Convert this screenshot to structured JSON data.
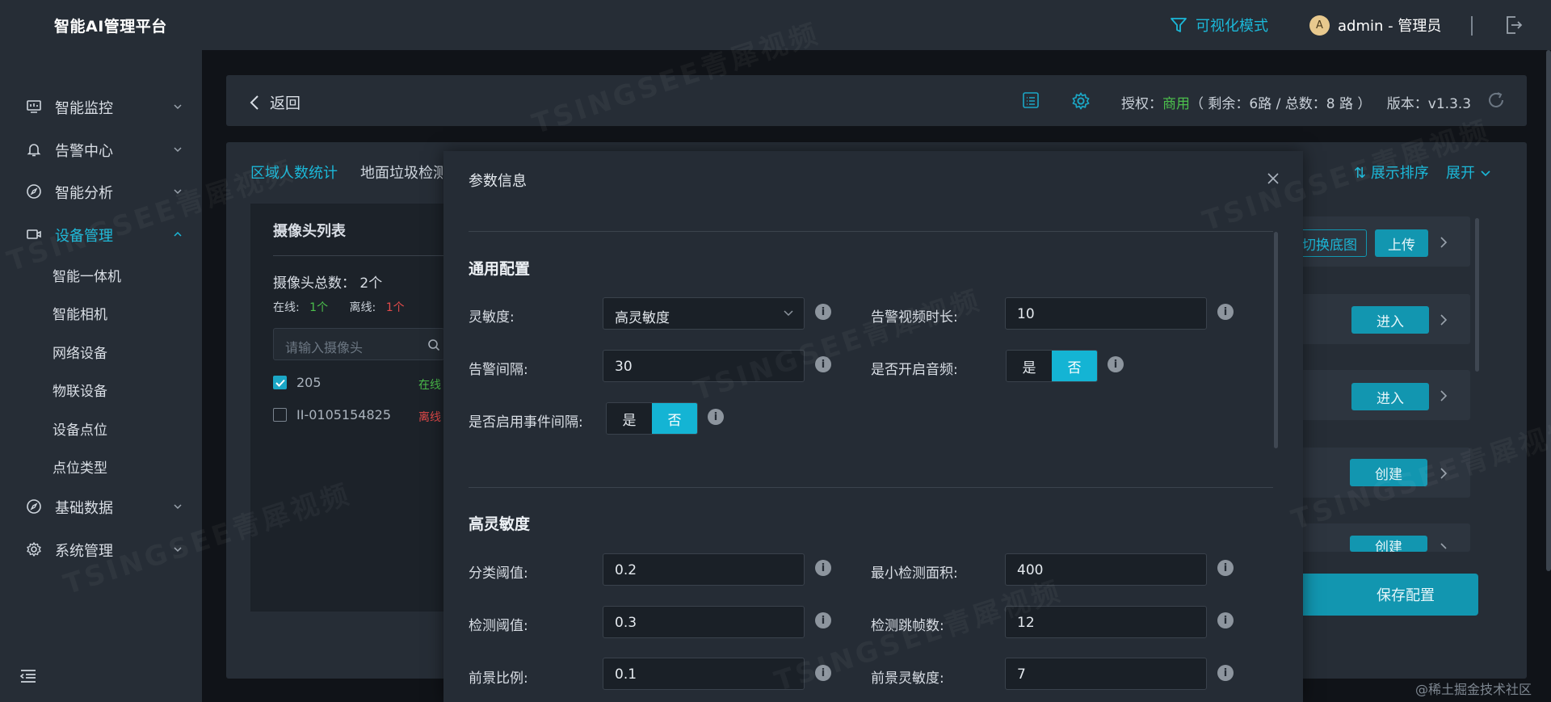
{
  "header": {
    "brand": "智能AI管理平台",
    "vis_mode": "可视化模式",
    "avatar_letter": "A",
    "user": "admin - 管理员"
  },
  "sidebar": {
    "items": [
      {
        "label": "智能监控",
        "icon": "monitor-icon"
      },
      {
        "label": "告警中心",
        "icon": "bell-icon"
      },
      {
        "label": "智能分析",
        "icon": "compass-icon"
      },
      {
        "label": "设备管理",
        "icon": "camera-icon"
      },
      {
        "label": "基础数据",
        "icon": "compass-icon"
      },
      {
        "label": "系统管理",
        "icon": "gear-icon"
      }
    ],
    "sub_items": [
      "智能一体机",
      "智能相机",
      "网络设备",
      "物联设备",
      "设备点位",
      "点位类型"
    ]
  },
  "topbar": {
    "back": "返回",
    "auth_label": "授权：",
    "auth_type": "商用",
    "auth_detail": "（ 剩余：6路 / 总数：8 路 ）",
    "version": "版本：v1.3.3"
  },
  "panel": {
    "tabs": [
      "区域人数统计",
      "地面垃圾检测"
    ],
    "sort_link": "展示排序",
    "expand_link": "展开",
    "camera_list": {
      "title": "摄像头列表",
      "total": "摄像头总数：  2个",
      "online_label": "在线:",
      "online_count": "1个",
      "offline_label": "离线:",
      "offline_count": "1个",
      "search_placeholder": "请输入摄像头",
      "rows": [
        {
          "name": "205",
          "state": "在线",
          "checked": true
        },
        {
          "name": "II-0105154825",
          "state": "离线",
          "checked": false
        }
      ]
    },
    "right_buttons": {
      "switch_bg": "切换底图",
      "upload": "上传",
      "enter1": "进入",
      "enter2": "进入",
      "create1": "创建",
      "create2": "创建",
      "save": "保存配置"
    }
  },
  "modal": {
    "title": "参数信息",
    "general_section": "通用配置",
    "sensitivity_label": "灵敏度:",
    "sensitivity_value": "高灵敏度",
    "video_duration_label": "告警视频时长:",
    "video_duration_value": "10",
    "alarm_interval_label": "告警间隔:",
    "alarm_interval_value": "30",
    "audio_label": "是否开启音频:",
    "event_interval_label": "是否启用事件间隔:",
    "yes": "是",
    "no": "否",
    "high_section": "高灵敏度",
    "class_thresh_label": "分类阈值:",
    "class_thresh_value": "0.2",
    "min_area_label": "最小检测面积:",
    "min_area_value": "400",
    "detect_thresh_label": "检测阈值:",
    "detect_thresh_value": "0.3",
    "skip_frames_label": "检测跳帧数:",
    "skip_frames_value": "12",
    "fg_ratio_label": "前景比例:",
    "fg_ratio_value": "0.1",
    "fg_sens_label": "前景灵敏度:",
    "fg_sens_value": "7"
  },
  "watermark": "TSINGSEE青犀视频",
  "corner_mark": "@稀土掘金技术社区"
}
